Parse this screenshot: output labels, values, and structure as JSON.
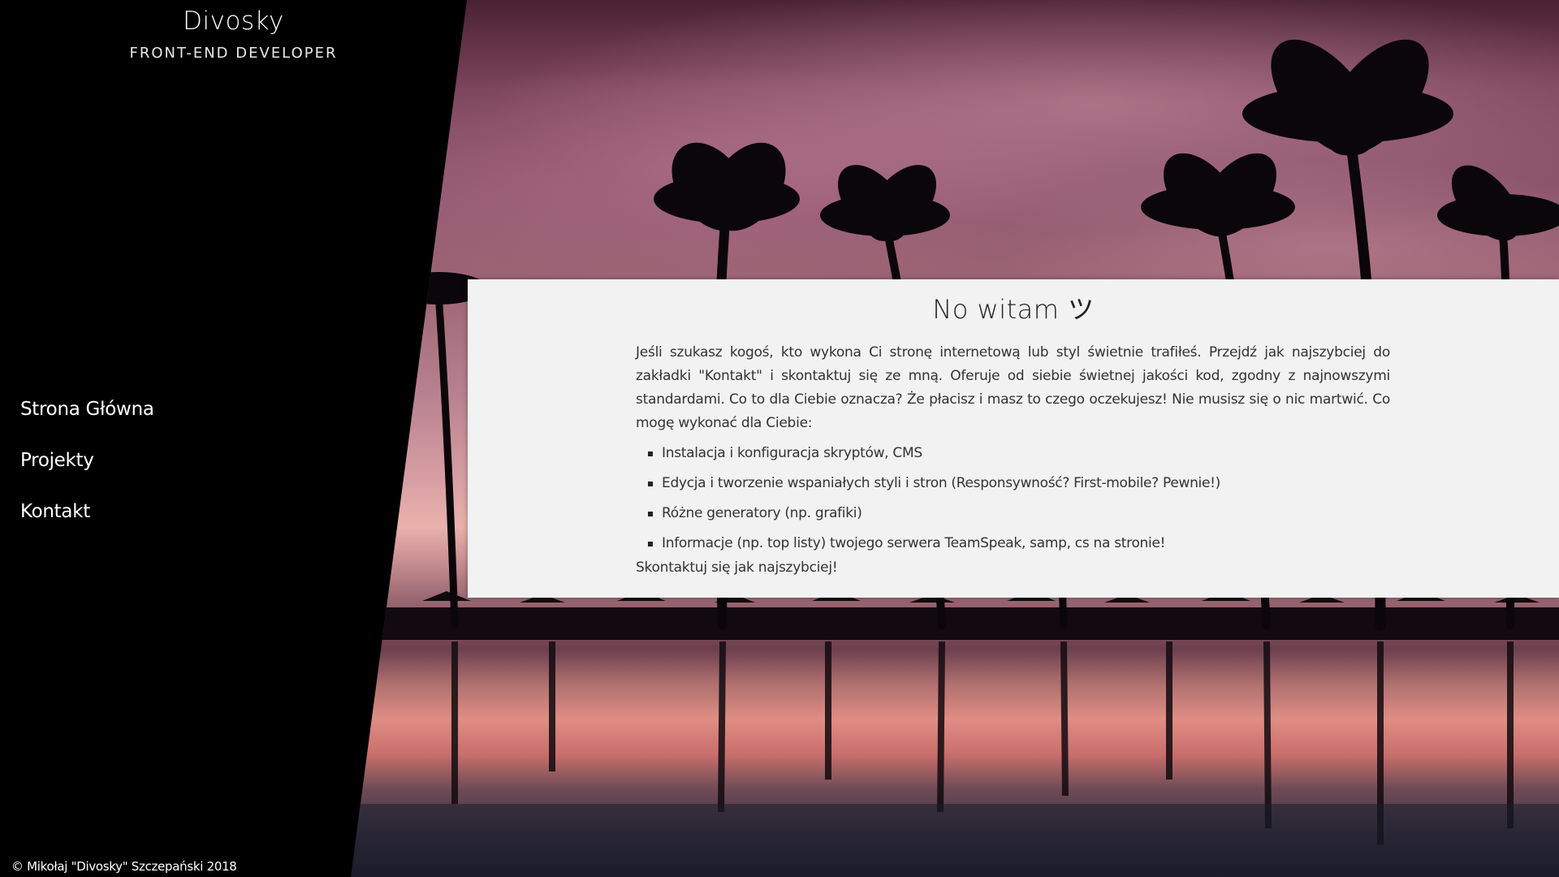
{
  "brand": {
    "name": "Divosky",
    "role": "FRONT-END DEVELOPER"
  },
  "nav": {
    "items": [
      {
        "label": "Strona Główna"
      },
      {
        "label": "Projekty"
      },
      {
        "label": "Kontakt"
      }
    ]
  },
  "content": {
    "title": "No witam ツ",
    "intro": "Jeśli szukasz kogoś, kto wykona Ci stronę internetową lub styl świetnie trafiłeś. Przejdź jak najszybciej do zakładki \"Kontakt\" i skontaktuj się ze mną. Oferuje od siebie świetnej jakości kod, zgodny z najnowszymi standardami. Co to dla Ciebie oznacza? Że płacisz i masz to czego oczekujesz! Nie musisz się o nic martwić. Co mogę wykonać dla Ciebie:",
    "services": [
      "Instalacja i konfiguracja skryptów, CMS",
      "Edycja i tworzenie wspaniałych styli i stron (Responsywność? First-mobile? Pewnie!)",
      "Różne generatory (np. grafiki)",
      "Informacje (np. top listy) twojego serwera TeamSpeak, samp, cs na stronie!"
    ],
    "outro": "Skontaktuj się jak najszybciej!"
  },
  "footer": {
    "copyright": "© Mikołaj \"Divosky\" Szczepański 2018"
  },
  "colors": {
    "sidebar": "#000000",
    "card": "#f2f2f2",
    "text": "#333333"
  }
}
